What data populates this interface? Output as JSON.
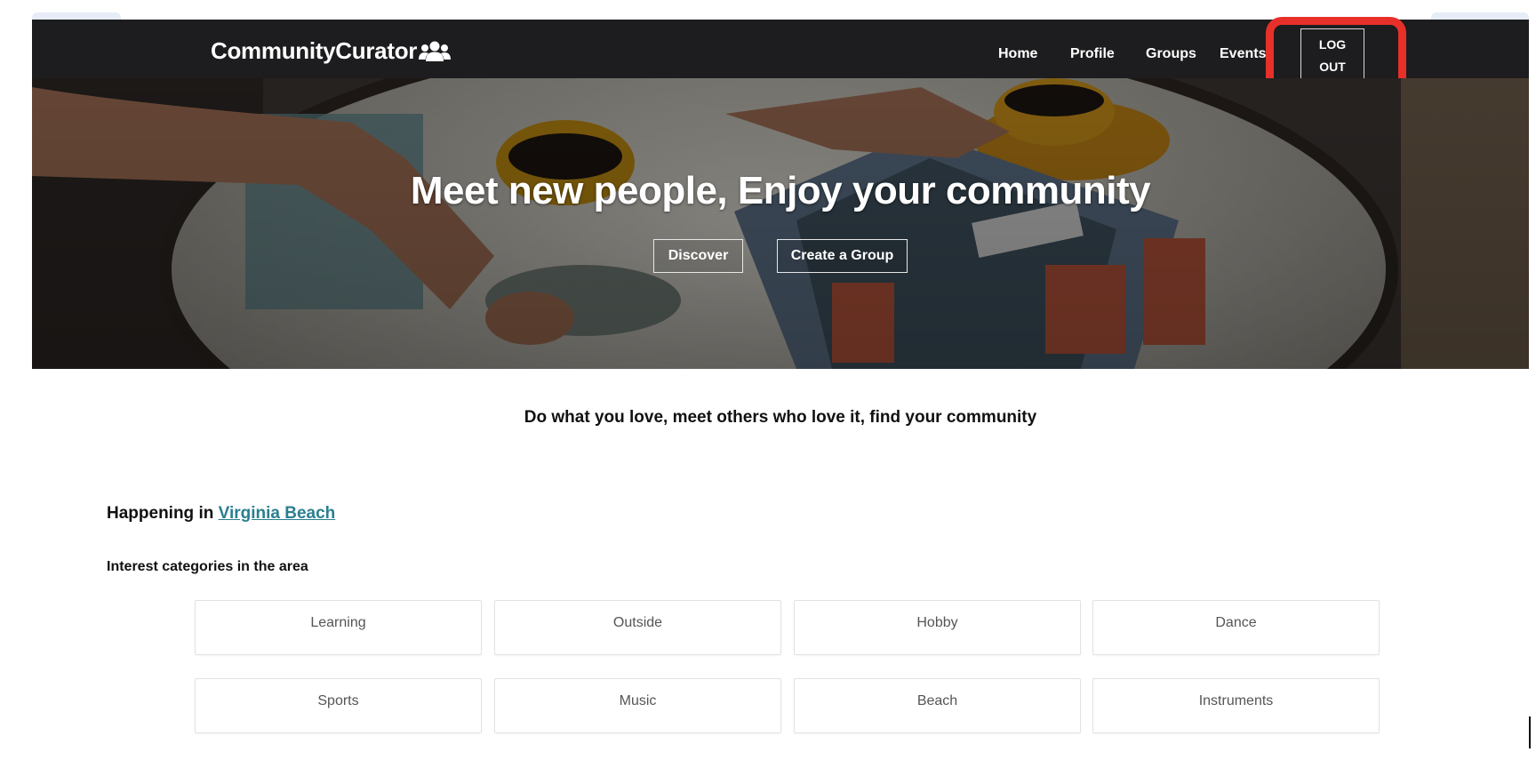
{
  "nav": {
    "brand": "CommunityCurator",
    "links": [
      "Home",
      "Profile",
      "Groups",
      "Events"
    ],
    "logout_line1": "LOG",
    "logout_line2": "OUT",
    "highlight_color": "#e8302a"
  },
  "hero": {
    "title": "Meet new people, Enjoy your community",
    "buttons": [
      "Discover",
      "Create a Group"
    ]
  },
  "tagline": "Do what you love, meet others who love it, find your community",
  "location": {
    "prefix": "Happening in",
    "city": "Virginia Beach",
    "link_color": "#2a7f8f"
  },
  "categories": {
    "heading": "Interest categories in the area",
    "items": [
      "Learning",
      "Outside",
      "Hobby",
      "Dance",
      "Sports",
      "Music",
      "Beach",
      "Instruments"
    ]
  }
}
